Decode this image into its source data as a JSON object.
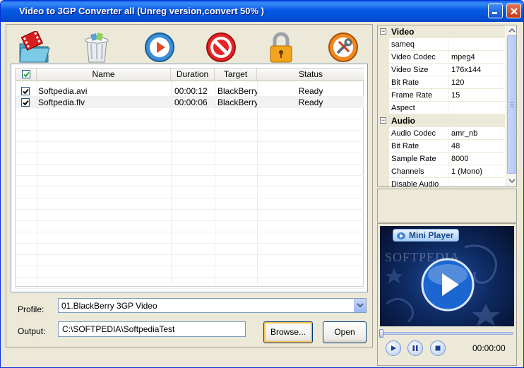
{
  "window": {
    "title": "Video to 3GP Converter all (Unreg version,convert 50% )"
  },
  "toolbar": {
    "icons": [
      "add-video-icon",
      "trash-icon",
      "convert-play-icon",
      "stop-icon",
      "lock-icon",
      "settings-tools-icon"
    ]
  },
  "file_list": {
    "columns": [
      "Name",
      "Duration",
      "Target",
      "Status"
    ],
    "rows": [
      {
        "checked": true,
        "name": "Softpedia.avi",
        "duration": "00:00:12",
        "target": "BlackBerry",
        "status": "Ready"
      },
      {
        "checked": true,
        "name": "Softpedia.flv",
        "duration": "00:00:06",
        "target": "BlackBerry",
        "status": "Ready"
      }
    ]
  },
  "profile": {
    "label": "Profile:",
    "value": "01.BlackBerry 3GP Video"
  },
  "output": {
    "label": "Output:",
    "value": "C:\\SOFTPEDIA\\SoftpediaTest"
  },
  "buttons": {
    "browse": "Browse...",
    "open": "Open"
  },
  "properties": {
    "video_category": "Video",
    "video": [
      {
        "name": "sameq",
        "value": ""
      },
      {
        "name": "Video Codec",
        "value": "mpeg4"
      },
      {
        "name": "Video Size",
        "value": "176x144"
      },
      {
        "name": "Bit Rate",
        "value": "120"
      },
      {
        "name": "Frame Rate",
        "value": "15"
      },
      {
        "name": "Aspect",
        "value": ""
      }
    ],
    "audio_category": "Audio",
    "audio": [
      {
        "name": "Audio Codec",
        "value": "amr_nb"
      },
      {
        "name": "Bit Rate",
        "value": "48"
      },
      {
        "name": "Sample Rate",
        "value": "8000"
      },
      {
        "name": "Channels",
        "value": "1 (Mono)"
      },
      {
        "name": "Disable Audio",
        "value": ""
      }
    ],
    "expander_symbol": "−"
  },
  "player": {
    "badge": "Mini Player",
    "watermark": "SOFTPEDIA",
    "time": "00:00:00",
    "seek_progress": 0
  },
  "colors": {
    "title_bar": "#0559e5",
    "accent": "#f9c155"
  }
}
